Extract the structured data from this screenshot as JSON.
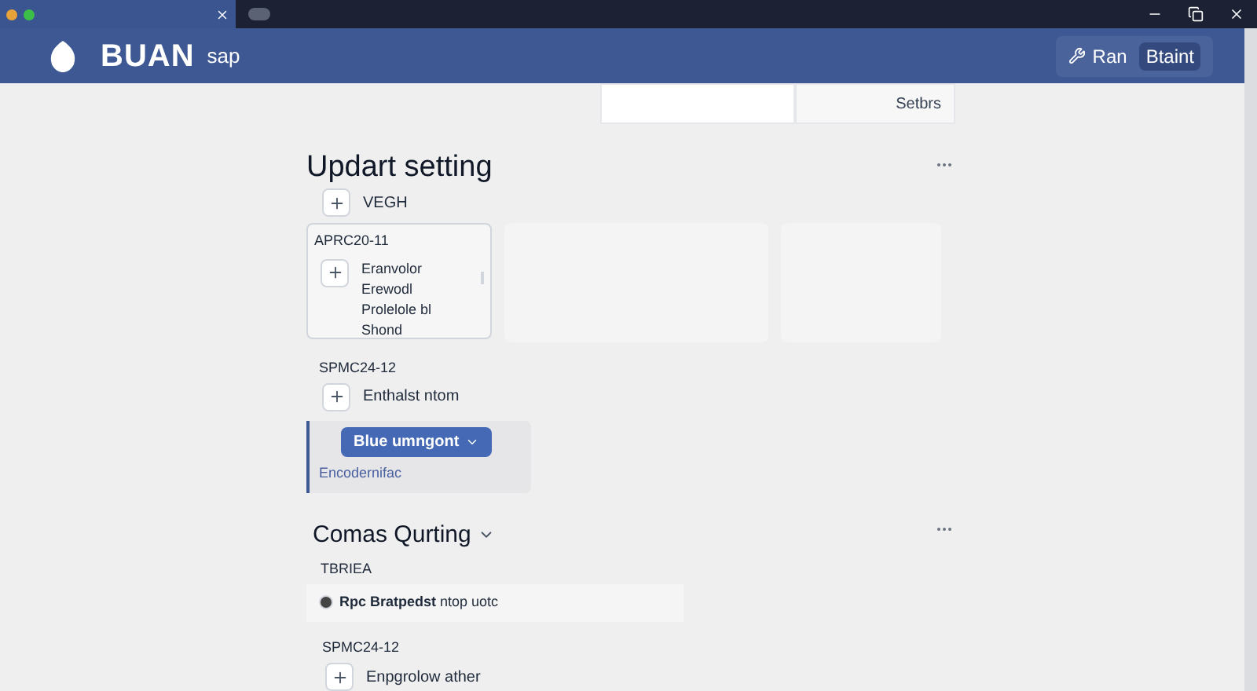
{
  "header": {
    "brand": "BUAN",
    "product": "sap",
    "actions": [
      {
        "label": "Ran",
        "kind": "icon-link"
      },
      {
        "label": "Btaint",
        "kind": "button"
      }
    ]
  },
  "toolbar": {
    "button": "Setbrs"
  },
  "section1": {
    "title": "Updart setting",
    "add_row": "VEGH",
    "card": {
      "code": "APRC20-11",
      "lines": [
        "Eranvolor",
        "Erewodl",
        "Prolelole bl",
        "Shond"
      ]
    },
    "group": {
      "code": "SPMC24-12",
      "item": "Enthalst ntom"
    },
    "panel": {
      "button": "Blue umngont",
      "link": "Encodernifac"
    }
  },
  "section2": {
    "title": "Comas Qurting",
    "expanded": true,
    "label": "TBRIEA",
    "row": "**Rpc Bratpedst** ntop uotc",
    "group": {
      "code": "SPMC24-12",
      "item": "Enpgrolow ather"
    }
  }
}
